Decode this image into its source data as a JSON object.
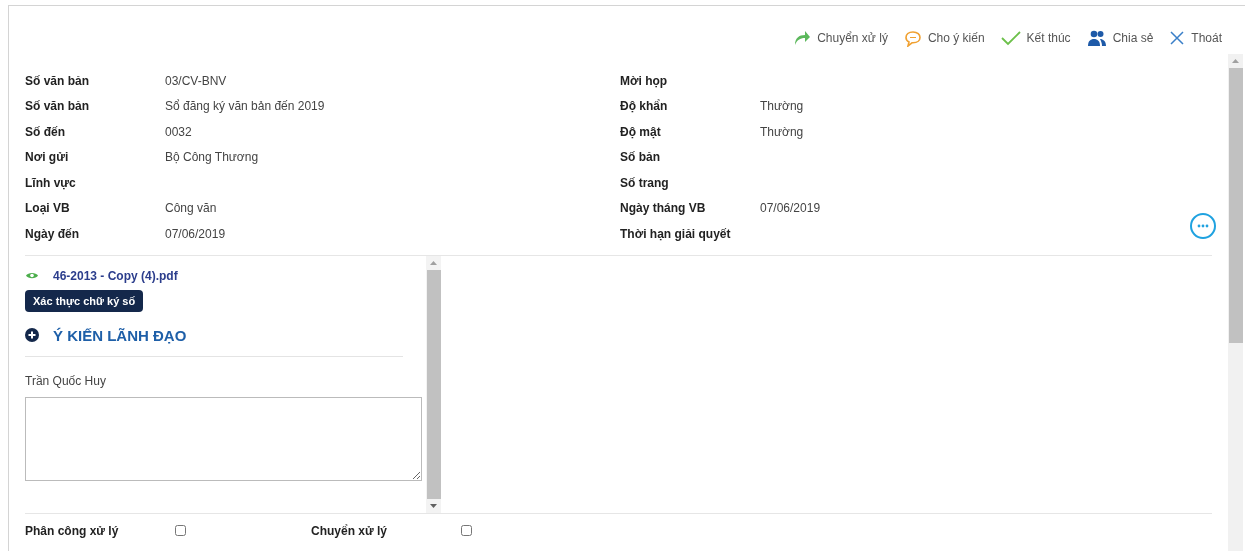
{
  "toolbar": [
    {
      "label": "Chuyển xử lý",
      "kind": "forward"
    },
    {
      "label": "Cho ý kiến",
      "kind": "comment"
    },
    {
      "label": "Kết thúc",
      "kind": "check"
    },
    {
      "label": "Chia sẻ",
      "kind": "users"
    },
    {
      "label": "Thoát",
      "kind": "close"
    }
  ],
  "fields_left": [
    {
      "label": "Số văn bản",
      "value": "03/CV-BNV"
    },
    {
      "label": "Số văn bản",
      "value": "Sổ đăng ký văn bản đến 2019"
    },
    {
      "label": "Số đến",
      "value": "0032"
    },
    {
      "label": "Nơi gửi",
      "value": "Bộ Công Thương"
    },
    {
      "label": "Lĩnh vực"
    },
    {
      "label": "Loại VB",
      "value": "Công văn"
    },
    {
      "label": "Ngày đến",
      "value": "07/06/2019"
    }
  ],
  "fields_right": [
    {
      "label": "Mời họp"
    },
    {
      "label": "Độ khẩn",
      "value": "Thường"
    },
    {
      "label": "Độ mật",
      "value": "Thường"
    },
    {
      "label": "Số bản"
    },
    {
      "label": "Số trang"
    },
    {
      "label": "Ngày tháng VB",
      "value": "07/06/2019"
    },
    {
      "label": "Thời hạn giải quyết"
    }
  ],
  "attachment": {
    "name": "46-2013 - Copy (4).pdf"
  },
  "verify_button": "Xác thực chữ ký số",
  "section_title": "Ý KIẾN LÃNH ĐẠO",
  "commenter": "Trần Quốc Huy",
  "checkboxes": [
    {
      "label": "Phân công xử lý",
      "checked": false
    },
    {
      "label": "Chuyển xử lý",
      "checked": false
    }
  ]
}
